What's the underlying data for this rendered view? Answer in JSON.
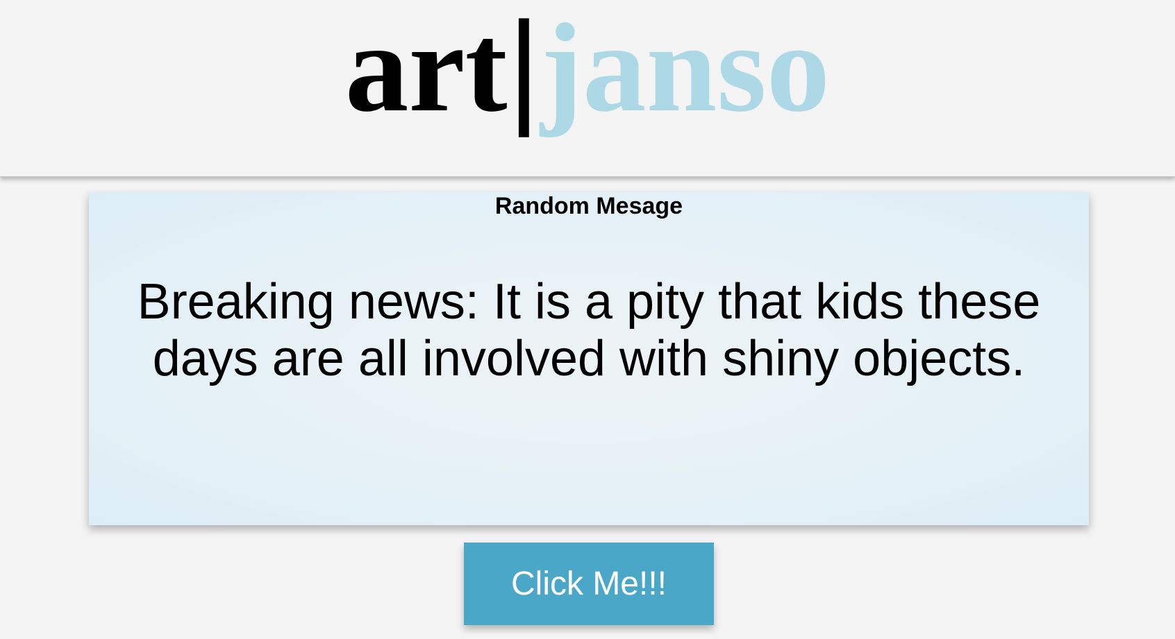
{
  "header": {
    "logo": {
      "part1": "art",
      "separator": "|",
      "part2": "janso"
    }
  },
  "card": {
    "title": "Random Mesage",
    "message": "Breaking news: It is a pity that kids these days are all involved with shiny objects."
  },
  "button": {
    "label": "Click Me!!!"
  },
  "colors": {
    "background": "#f4f4f4",
    "logo_accent": "#add8e6",
    "card_background": "#e5f1f7",
    "button_background": "#4ba7c8",
    "button_text": "#ffffff"
  }
}
